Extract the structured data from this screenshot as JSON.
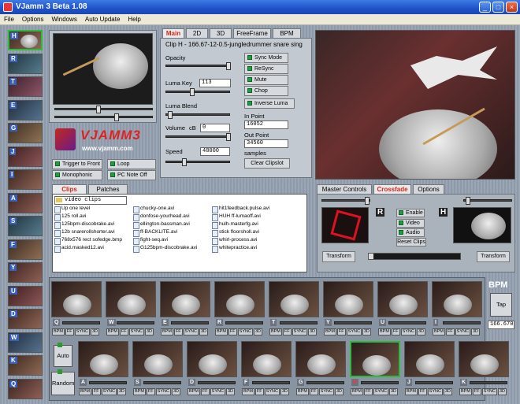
{
  "window": {
    "title": "VJamm 3 Beta 1.08",
    "minimize": "_",
    "maximize": "□",
    "close": "×"
  },
  "menu": [
    "File",
    "Options",
    "Windows",
    "Auto Update",
    "Help"
  ],
  "side_keys": [
    "H",
    "R",
    "T",
    "E",
    "G",
    "J",
    "I",
    "A",
    "S",
    "F",
    "Y",
    "U",
    "D",
    "W",
    "K",
    "Q"
  ],
  "main_tabs": [
    "Main",
    "2D",
    "3D",
    "FreeFrame",
    "BPM"
  ],
  "clip": {
    "title": "Clip H - 166.67-12-0.5-jungledrummer snare sing",
    "opacity_label": "Opacity",
    "luma_key_label": "Luma Key",
    "luma_key_value": "113",
    "luma_blend_label": "Luma Blend",
    "volume_label": "Volume",
    "volume_unit": "cB",
    "volume_value": "0",
    "speed_label": "Speed",
    "speed_value": "48000",
    "in_point_label": "In Point",
    "in_point_value": "16052",
    "out_point_label": "Out Point",
    "out_point_value": "34560",
    "samples_label": "samples",
    "clear_clipslot": "Clear Clipslot",
    "options": [
      "Sync Mode",
      "ReSync",
      "Mute",
      "Chop"
    ],
    "inverse_luma": "Inverse Luma"
  },
  "logo": {
    "brand": "VJAMM3",
    "url": "www.vjamm.com"
  },
  "left_options": [
    "Trigger to Front",
    "Loop",
    "Monophonic",
    "PC Note Off"
  ],
  "browser": {
    "tabs": [
      "Clips",
      "Patches"
    ],
    "folder": "video clips",
    "col1": [
      "Up one level",
      "125 roll.avi",
      "125bpm-discobrake.avi",
      "12b snarerollshorter.avi",
      "768x576 rect sofedge.bmp",
      "acid.masked12.avi"
    ],
    "col2": [
      "chucky-one.avi",
      "donfose-yourhead.avi",
      "ellington-bassman.avi",
      "ff-BACKLITE.avi",
      "fight-seq.avi",
      "G125bpm-discobrake.avi"
    ],
    "col3": [
      "hit1feedback.pulse.avi",
      "HUH ff-lumaoff.avi",
      "hulh-masterfg.avi",
      "stick floorsholl.avi",
      "whirl-process.avi",
      "whitepractice.avi"
    ]
  },
  "master": {
    "tabs": [
      "Master Controls",
      "Crossfade",
      "Options"
    ],
    "left_key": "R",
    "right_key": "H",
    "toggles": [
      "Enable",
      "Video",
      "Audio"
    ],
    "reset": "Reset Clips",
    "transform_left": "Transform",
    "transform_right": "Transform"
  },
  "bpm": {
    "label": "BPM",
    "tap": "Tap",
    "value": "166.670"
  },
  "row1_keys": [
    "Q",
    "W",
    "E",
    "R",
    "T",
    "Y",
    "U",
    "I"
  ],
  "row2_keys": [
    "A",
    "S",
    "D",
    "F",
    "G",
    "H",
    "J",
    "K"
  ],
  "cell_ctrls": [
    "BPM",
    "FF",
    "SYNC",
    "3D"
  ],
  "auto_label": "Auto",
  "random_label": "Random",
  "colors": {
    "title_bar": "#1f52c9",
    "active_green": "#2dbb3b",
    "active_tab_red": "#d21111"
  }
}
